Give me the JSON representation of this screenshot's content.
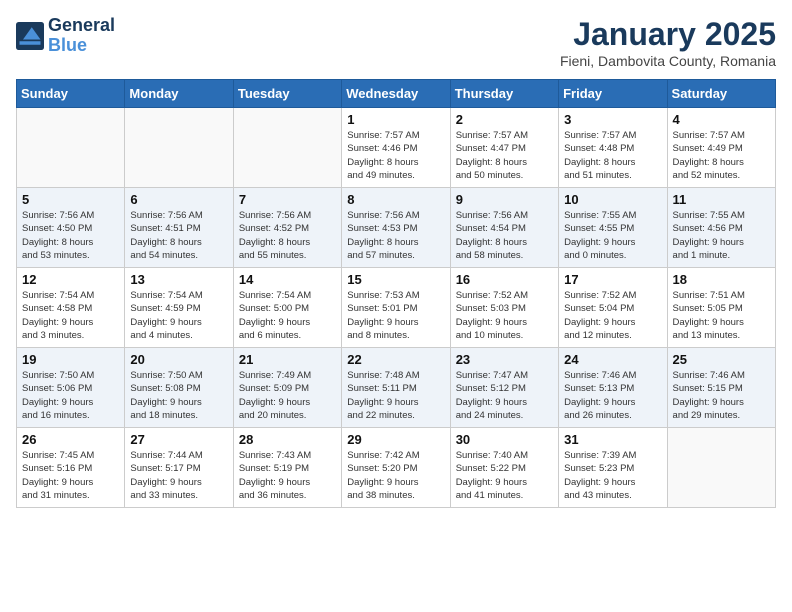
{
  "header": {
    "logo_line1": "General",
    "logo_line2": "Blue",
    "month": "January 2025",
    "location": "Fieni, Dambovita County, Romania"
  },
  "weekdays": [
    "Sunday",
    "Monday",
    "Tuesday",
    "Wednesday",
    "Thursday",
    "Friday",
    "Saturday"
  ],
  "weeks": [
    [
      {
        "day": "",
        "info": ""
      },
      {
        "day": "",
        "info": ""
      },
      {
        "day": "",
        "info": ""
      },
      {
        "day": "1",
        "info": "Sunrise: 7:57 AM\nSunset: 4:46 PM\nDaylight: 8 hours\nand 49 minutes."
      },
      {
        "day": "2",
        "info": "Sunrise: 7:57 AM\nSunset: 4:47 PM\nDaylight: 8 hours\nand 50 minutes."
      },
      {
        "day": "3",
        "info": "Sunrise: 7:57 AM\nSunset: 4:48 PM\nDaylight: 8 hours\nand 51 minutes."
      },
      {
        "day": "4",
        "info": "Sunrise: 7:57 AM\nSunset: 4:49 PM\nDaylight: 8 hours\nand 52 minutes."
      }
    ],
    [
      {
        "day": "5",
        "info": "Sunrise: 7:56 AM\nSunset: 4:50 PM\nDaylight: 8 hours\nand 53 minutes."
      },
      {
        "day": "6",
        "info": "Sunrise: 7:56 AM\nSunset: 4:51 PM\nDaylight: 8 hours\nand 54 minutes."
      },
      {
        "day": "7",
        "info": "Sunrise: 7:56 AM\nSunset: 4:52 PM\nDaylight: 8 hours\nand 55 minutes."
      },
      {
        "day": "8",
        "info": "Sunrise: 7:56 AM\nSunset: 4:53 PM\nDaylight: 8 hours\nand 57 minutes."
      },
      {
        "day": "9",
        "info": "Sunrise: 7:56 AM\nSunset: 4:54 PM\nDaylight: 8 hours\nand 58 minutes."
      },
      {
        "day": "10",
        "info": "Sunrise: 7:55 AM\nSunset: 4:55 PM\nDaylight: 9 hours\nand 0 minutes."
      },
      {
        "day": "11",
        "info": "Sunrise: 7:55 AM\nSunset: 4:56 PM\nDaylight: 9 hours\nand 1 minute."
      }
    ],
    [
      {
        "day": "12",
        "info": "Sunrise: 7:54 AM\nSunset: 4:58 PM\nDaylight: 9 hours\nand 3 minutes."
      },
      {
        "day": "13",
        "info": "Sunrise: 7:54 AM\nSunset: 4:59 PM\nDaylight: 9 hours\nand 4 minutes."
      },
      {
        "day": "14",
        "info": "Sunrise: 7:54 AM\nSunset: 5:00 PM\nDaylight: 9 hours\nand 6 minutes."
      },
      {
        "day": "15",
        "info": "Sunrise: 7:53 AM\nSunset: 5:01 PM\nDaylight: 9 hours\nand 8 minutes."
      },
      {
        "day": "16",
        "info": "Sunrise: 7:52 AM\nSunset: 5:03 PM\nDaylight: 9 hours\nand 10 minutes."
      },
      {
        "day": "17",
        "info": "Sunrise: 7:52 AM\nSunset: 5:04 PM\nDaylight: 9 hours\nand 12 minutes."
      },
      {
        "day": "18",
        "info": "Sunrise: 7:51 AM\nSunset: 5:05 PM\nDaylight: 9 hours\nand 13 minutes."
      }
    ],
    [
      {
        "day": "19",
        "info": "Sunrise: 7:50 AM\nSunset: 5:06 PM\nDaylight: 9 hours\nand 16 minutes."
      },
      {
        "day": "20",
        "info": "Sunrise: 7:50 AM\nSunset: 5:08 PM\nDaylight: 9 hours\nand 18 minutes."
      },
      {
        "day": "21",
        "info": "Sunrise: 7:49 AM\nSunset: 5:09 PM\nDaylight: 9 hours\nand 20 minutes."
      },
      {
        "day": "22",
        "info": "Sunrise: 7:48 AM\nSunset: 5:11 PM\nDaylight: 9 hours\nand 22 minutes."
      },
      {
        "day": "23",
        "info": "Sunrise: 7:47 AM\nSunset: 5:12 PM\nDaylight: 9 hours\nand 24 minutes."
      },
      {
        "day": "24",
        "info": "Sunrise: 7:46 AM\nSunset: 5:13 PM\nDaylight: 9 hours\nand 26 minutes."
      },
      {
        "day": "25",
        "info": "Sunrise: 7:46 AM\nSunset: 5:15 PM\nDaylight: 9 hours\nand 29 minutes."
      }
    ],
    [
      {
        "day": "26",
        "info": "Sunrise: 7:45 AM\nSunset: 5:16 PM\nDaylight: 9 hours\nand 31 minutes."
      },
      {
        "day": "27",
        "info": "Sunrise: 7:44 AM\nSunset: 5:17 PM\nDaylight: 9 hours\nand 33 minutes."
      },
      {
        "day": "28",
        "info": "Sunrise: 7:43 AM\nSunset: 5:19 PM\nDaylight: 9 hours\nand 36 minutes."
      },
      {
        "day": "29",
        "info": "Sunrise: 7:42 AM\nSunset: 5:20 PM\nDaylight: 9 hours\nand 38 minutes."
      },
      {
        "day": "30",
        "info": "Sunrise: 7:40 AM\nSunset: 5:22 PM\nDaylight: 9 hours\nand 41 minutes."
      },
      {
        "day": "31",
        "info": "Sunrise: 7:39 AM\nSunset: 5:23 PM\nDaylight: 9 hours\nand 43 minutes."
      },
      {
        "day": "",
        "info": ""
      }
    ]
  ]
}
